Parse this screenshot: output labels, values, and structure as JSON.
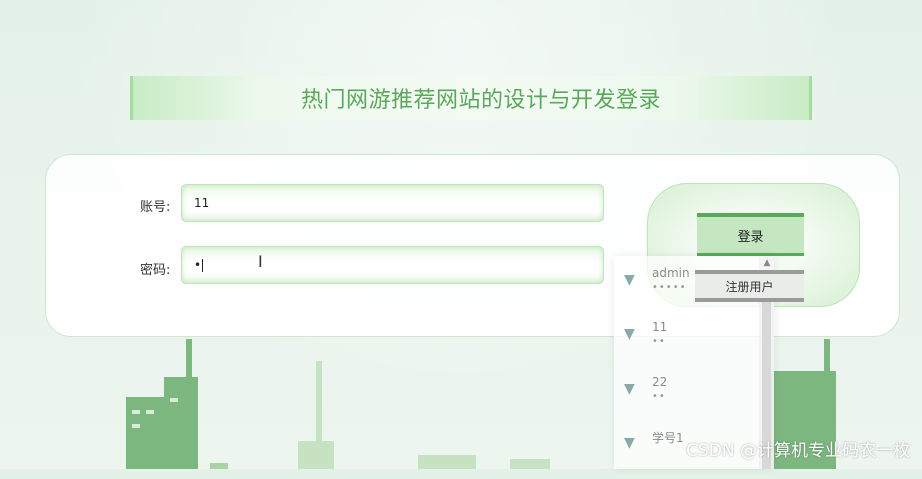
{
  "title": "热门网游推荐网站的设计与开发登录",
  "form": {
    "account_label": "账号:",
    "account_value": "11",
    "password_label": "密码:",
    "password_value": "•"
  },
  "buttons": {
    "login_label": "登录",
    "register_label": "注册用户"
  },
  "autocomplete": {
    "items": [
      {
        "username": "admin",
        "password_mask": "•••••"
      },
      {
        "username": "11",
        "password_mask": "••"
      },
      {
        "username": "22",
        "password_mask": "••"
      },
      {
        "username": "学号1",
        "password_mask": ""
      }
    ]
  },
  "watermark": "CSDN @计算机专业码农一枚",
  "colors": {
    "accent": "#5aa85a",
    "title_text": "#5aa85a",
    "card_border": "#cfe8cb",
    "button_green": "#c4e6c1"
  }
}
